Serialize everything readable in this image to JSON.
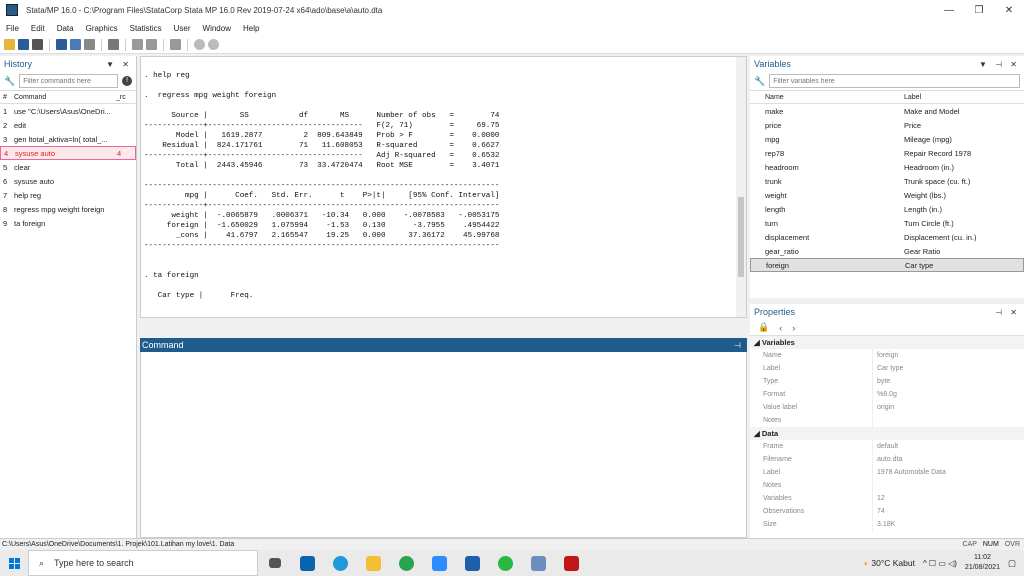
{
  "window": {
    "title": "Stata/MP 16.0 - C:\\Program Files\\StataCorp Stata MP 16.0 Rev 2019-07-24 x64\\ado\\base\\a\\auto.dta"
  },
  "menu": [
    "File",
    "Edit",
    "Data",
    "Graphics",
    "Statistics",
    "User",
    "Window",
    "Help"
  ],
  "history": {
    "title": "History",
    "filter_placeholder": "Filter commands here",
    "col_num": "#",
    "col_cmd": "Command",
    "col_rc": "_rc",
    "rows": [
      {
        "n": "1",
        "cmd": "use \"C:\\Users\\Asus\\OneDri...",
        "rc": ""
      },
      {
        "n": "2",
        "cmd": "edit",
        "rc": ""
      },
      {
        "n": "3",
        "cmd": "gen ltotal_aktiva=ln( total_...",
        "rc": ""
      },
      {
        "n": "4",
        "cmd": "sysuse auto",
        "rc": "4"
      },
      {
        "n": "5",
        "cmd": "clear",
        "rc": ""
      },
      {
        "n": "6",
        "cmd": "sysuse auto",
        "rc": ""
      },
      {
        "n": "7",
        "cmd": "help reg",
        "rc": ""
      },
      {
        "n": "8",
        "cmd": " regress mpg weight foreign",
        "rc": ""
      },
      {
        "n": "9",
        "cmd": "ta foreign",
        "rc": ""
      }
    ]
  },
  "results": {
    "text": ". help reg\n\n.  regress mpg weight foreign\n\n      Source |       SS           df       MS      Number of obs   =        74\n-------------+----------------------------------   F(2, 71)        =     69.75\n       Model |   1619.2877         2  809.643849   Prob > F        =    0.0000\n    Residual |  824.171761        71   11.608053   R-squared       =    0.6627\n-------------+----------------------------------   Adj R-squared   =    0.6532\n       Total |  2443.45946        73  33.4720474   Root MSE        =    3.4071\n\n------------------------------------------------------------------------------\n         mpg |      Coef.   Std. Err.      t    P>|t|     [95% Conf. Interval]\n-------------+----------------------------------------------------------------\n      weight |  -.0065879   .0006371   -10.34   0.000    -.0078583   -.0053175\n     foreign |  -1.650029   1.075994    -1.53   0.130      -3.7955    .4954422\n       _cons |    41.6797   2.165547    19.25   0.000     37.36172    45.99768\n------------------------------------------------------------------------------\n\n\n. ta foreign\n\n   Car type |      Freq."
  },
  "command": {
    "title": "Command",
    "value": ""
  },
  "variables": {
    "title": "Variables",
    "filter_placeholder": "Filter variables here",
    "col_name": "Name",
    "col_label": "Label",
    "rows": [
      {
        "name": "make",
        "label": "Make and Model"
      },
      {
        "name": "price",
        "label": "Price"
      },
      {
        "name": "mpg",
        "label": "Mileage (mpg)"
      },
      {
        "name": "rep78",
        "label": "Repair Record 1978"
      },
      {
        "name": "headroom",
        "label": "Headroom (in.)"
      },
      {
        "name": "trunk",
        "label": "Trunk space (cu. ft.)"
      },
      {
        "name": "weight",
        "label": "Weight (lbs.)"
      },
      {
        "name": "length",
        "label": "Length (in.)"
      },
      {
        "name": "turn",
        "label": "Turn Circle (ft.)"
      },
      {
        "name": "displacement",
        "label": "Displacement (cu. in.)"
      },
      {
        "name": "gear_ratio",
        "label": "Gear Ratio"
      },
      {
        "name": "foreign",
        "label": "Car type"
      }
    ]
  },
  "properties": {
    "title": "Properties",
    "variables_section": "Variables",
    "variables": [
      {
        "k": "Name",
        "v": "foreign"
      },
      {
        "k": "Label",
        "v": "Car type"
      },
      {
        "k": "Type",
        "v": "byte"
      },
      {
        "k": "Format",
        "v": "%8.0g"
      },
      {
        "k": "Value label",
        "v": "origin"
      },
      {
        "k": "Notes",
        "v": ""
      }
    ],
    "data_section": "Data",
    "data": [
      {
        "k": "Frame",
        "v": "default"
      },
      {
        "k": "Filename",
        "v": "auto.dta"
      },
      {
        "k": "Label",
        "v": "1978 Automobile Data"
      },
      {
        "k": "Notes",
        "v": ""
      },
      {
        "k": "Variables",
        "v": "12"
      },
      {
        "k": "Observations",
        "v": "74"
      },
      {
        "k": "Size",
        "v": "3.18K"
      }
    ]
  },
  "status": {
    "path": "C:\\Users\\Asus\\OneDrive\\Documents\\1. Projek\\101.Latihan my love\\1. Data",
    "caps": "CAP",
    "num": "NUM",
    "ovr": "OVR"
  },
  "taskbar": {
    "search_placeholder": "Type here to search",
    "weather": "30°C  Kabut",
    "time": "11:02",
    "date": "21/08/2021"
  }
}
